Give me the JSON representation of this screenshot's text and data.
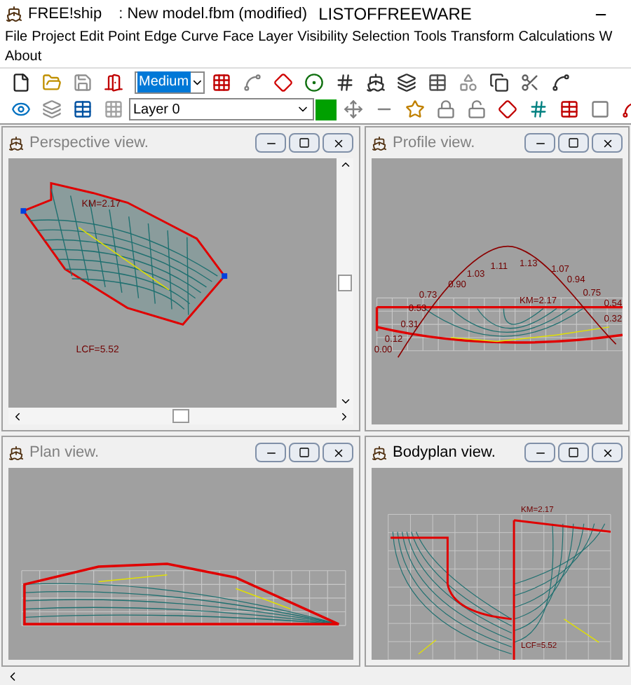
{
  "window": {
    "app_name": "FREE!ship",
    "title": ": New model.fbm (modified)",
    "watermark_text": "LISTOFFREEWARE"
  },
  "menu": {
    "rows": [
      [
        "File",
        "Project",
        "Edit",
        "Point",
        "Edge",
        "Curve",
        "Face",
        "Layer",
        "Visibility",
        "Selection",
        "Tools",
        "Transform",
        "Calculations",
        "W"
      ],
      [
        "About"
      ]
    ]
  },
  "toolbar": {
    "precision": "Medium",
    "layer": "Layer 0"
  },
  "views": [
    {
      "kind": "perspective",
      "title": "Perspective view.",
      "active": false,
      "labels": [
        "KM=2.17",
        "LCF=5.52"
      ]
    },
    {
      "kind": "profile",
      "title": "Profile view.",
      "active": false,
      "labels": [
        "0.00",
        "0.12",
        "0.31",
        "0.53",
        "0.73",
        "0.90",
        "1.03",
        "1.11",
        "1.13",
        "1.07",
        "0.94",
        "0.75",
        "0.54",
        "0.32",
        "KM=2.17"
      ]
    },
    {
      "kind": "plan",
      "title": "Plan view.",
      "active": false
    },
    {
      "kind": "bodyplan",
      "title": "Bodyplan view.",
      "active": true,
      "labels": [
        "KM=2.17",
        "LCF=5.52"
      ]
    }
  ]
}
